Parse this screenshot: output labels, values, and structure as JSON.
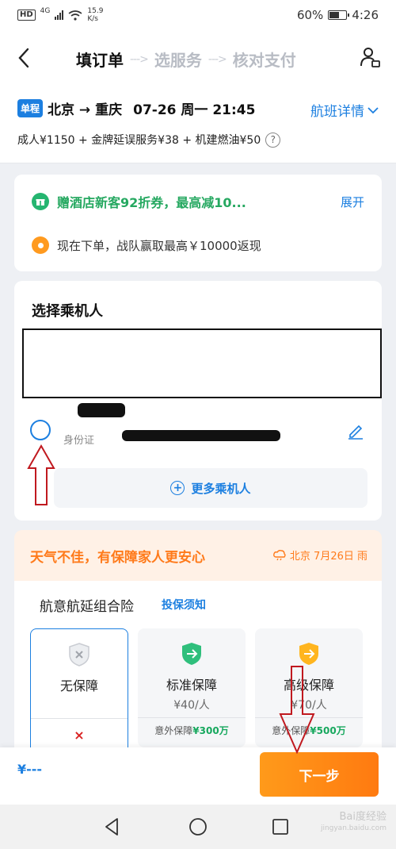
{
  "status_bar": {
    "hd": "HD",
    "network": "4G",
    "speed_value": "15.9",
    "speed_unit": "K/s",
    "battery_percent": "60%",
    "battery_level": 0.6,
    "time": "4:26"
  },
  "header": {
    "steps": [
      "填订单",
      "选服务",
      "核对支付"
    ],
    "active_step": 0,
    "step_arrow": "--->"
  },
  "flight": {
    "trip_type": "单程",
    "route": "北京 → 重庆",
    "datetime": "07-26 周一 21:45",
    "detail_link": "航班详情",
    "price_breakdown": "成人¥1150 + 金牌延误服务¥38 + 机建燃油¥50",
    "help_icon": "?"
  },
  "promos": {
    "hotel_coupon": "赠酒店新客92折券，最高减10...",
    "expand_label": "展开",
    "cashback": "现在下单，战队赢取最高￥10000返现"
  },
  "passengers": {
    "title": "选择乘机人",
    "id_label": "身份证",
    "more_label": "更多乘机人"
  },
  "weather": {
    "banner_text": "天气不佳，有保障家人更安心",
    "info": "北京 7月26日 雨"
  },
  "insurance": {
    "title": "航意航延组合险",
    "notice_link": "投保须知",
    "plans": [
      {
        "name": "无保障",
        "price": "",
        "coverage_prefix": "",
        "coverage_amount": "",
        "selected": true,
        "color": "#b9bcc2"
      },
      {
        "name": "标准保障",
        "price": "¥40/人",
        "coverage_prefix": "意外保障",
        "coverage_amount": "¥300万",
        "selected": false,
        "color": "#2fbf7c"
      },
      {
        "name": "高级保障",
        "price": "¥70/人",
        "coverage_prefix": "意外保障",
        "coverage_amount": "¥500万",
        "selected": false,
        "color": "#ffb51f"
      }
    ],
    "none_mark": "×"
  },
  "bottom": {
    "total": "¥---",
    "next_label": "下一步"
  },
  "watermark": {
    "brand": "Bai度经验",
    "url": "jingyan.baidu.com"
  },
  "colors": {
    "accent": "#1c7fe0",
    "orange": "#ff8a1a",
    "green": "#25a860",
    "annotation": "#c0191f"
  }
}
